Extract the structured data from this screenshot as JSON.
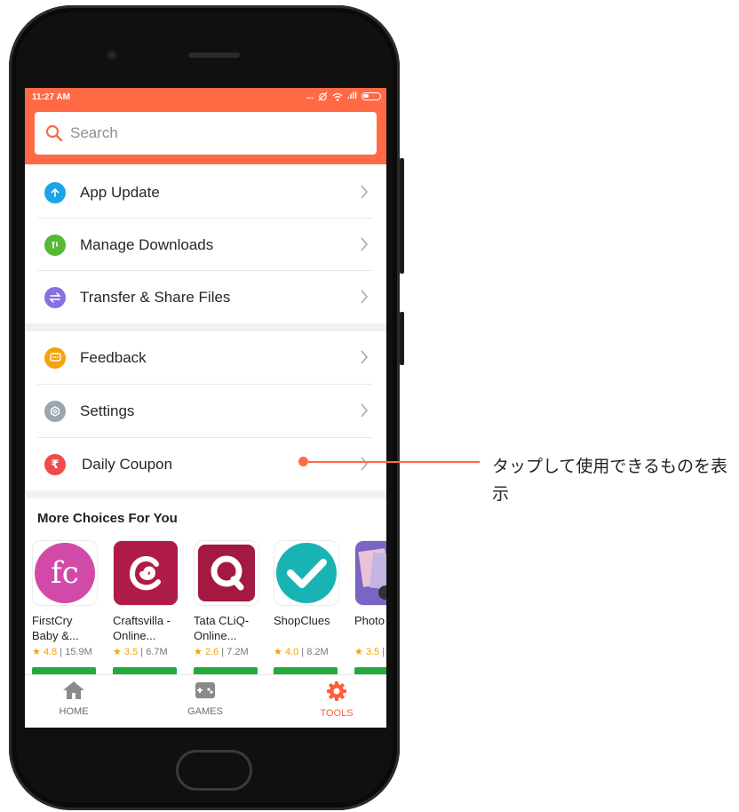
{
  "status_bar": {
    "time": "11:27 AM",
    "dots": "...",
    "signal": ".ıll"
  },
  "search": {
    "placeholder": "Search"
  },
  "menu": [
    {
      "label": "App Update",
      "icon": "arrow-up-icon",
      "color": "#1aa5e8"
    },
    {
      "label": "Manage Downloads",
      "icon": "download-icon",
      "color": "#56b834"
    },
    {
      "label": "Transfer & Share Files",
      "icon": "transfer-icon",
      "color": "#8a6fe0"
    },
    {
      "label": "Feedback",
      "icon": "chat-icon",
      "color": "#f5a20c"
    },
    {
      "label": "Settings",
      "icon": "gear-icon",
      "color": "#9aa7b3"
    },
    {
      "label": "Daily Coupon",
      "icon": "rupee-icon",
      "color": "#f04b4b"
    }
  ],
  "more_choices": {
    "title": "More Choices For You",
    "apps": [
      {
        "name": "FirstCry\nBaby &...",
        "rating": "4.8",
        "downloads": "15.9M",
        "icon": "firstcry-logo",
        "color": "#d24aa8"
      },
      {
        "name": "Craftsvilla -\nOnline...",
        "rating": "3.5",
        "downloads": "6.7M",
        "icon": "craftsvilla-logo",
        "color": "#b01c48"
      },
      {
        "name": "Tata CLiQ-\nOnline...",
        "rating": "2.6",
        "downloads": "7.2M",
        "icon": "tatacliq-logo",
        "color": "#a31942"
      },
      {
        "name": "ShopClues",
        "rating": "4.0",
        "downloads": "8.2M",
        "icon": "shopclues-logo",
        "color": "#1ab3b3"
      },
      {
        "name": "Photo",
        "rating": "3.5",
        "downloads": "",
        "icon": "photo-app-logo",
        "color": "#b8a8d8"
      }
    ]
  },
  "bottom_nav": [
    {
      "label": "HOME",
      "icon": "home-icon",
      "active": false
    },
    {
      "label": "GAMES",
      "icon": "gamepad-icon",
      "active": false
    },
    {
      "label": "TOOLS",
      "icon": "gear-icon",
      "active": true
    }
  ],
  "callout": {
    "text": "タップして使用できるものを表示"
  },
  "colors": {
    "accent": "#ff6a45",
    "install": "#22aa3a",
    "active_tab": "#ff5c38"
  }
}
